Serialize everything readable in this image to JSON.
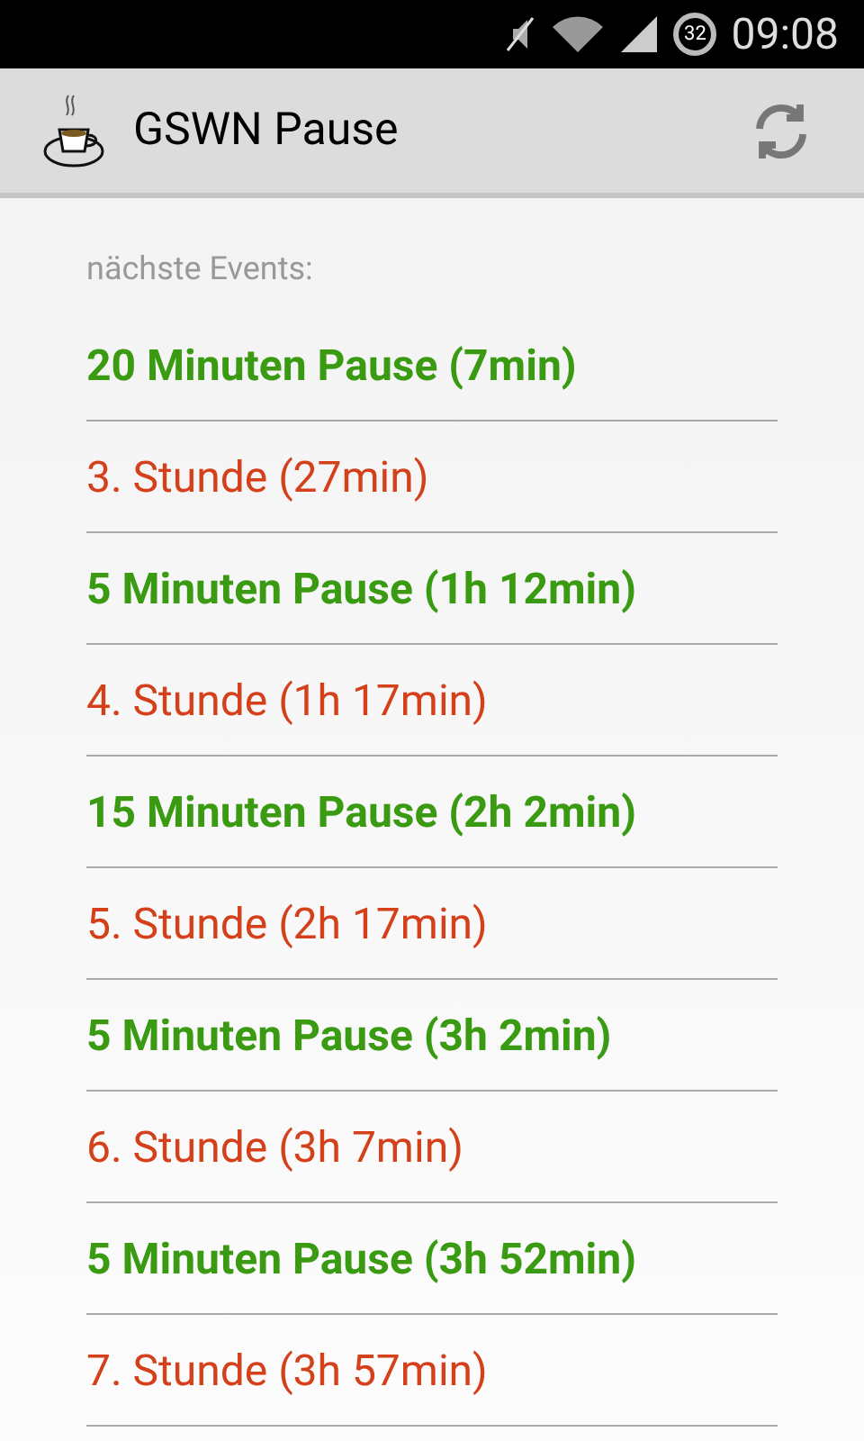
{
  "status_bar": {
    "battery": "32",
    "time": "09:08"
  },
  "app_bar": {
    "title": "GSWN Pause"
  },
  "section_label": "nächste Events:",
  "events": [
    {
      "kind": "break",
      "text": "20 Minuten Pause (7min)"
    },
    {
      "kind": "lesson",
      "text": "3. Stunde (27min)"
    },
    {
      "kind": "break",
      "text": "5 Minuten Pause (1h 12min)"
    },
    {
      "kind": "lesson",
      "text": "4. Stunde (1h 17min)"
    },
    {
      "kind": "break",
      "text": "15 Minuten Pause (2h 2min)"
    },
    {
      "kind": "lesson",
      "text": "5. Stunde (2h 17min)"
    },
    {
      "kind": "break",
      "text": "5 Minuten Pause (3h 2min)"
    },
    {
      "kind": "lesson",
      "text": "6. Stunde (3h 7min)"
    },
    {
      "kind": "break",
      "text": "5 Minuten Pause (3h 52min)"
    },
    {
      "kind": "lesson",
      "text": "7. Stunde (3h 57min)"
    }
  ]
}
